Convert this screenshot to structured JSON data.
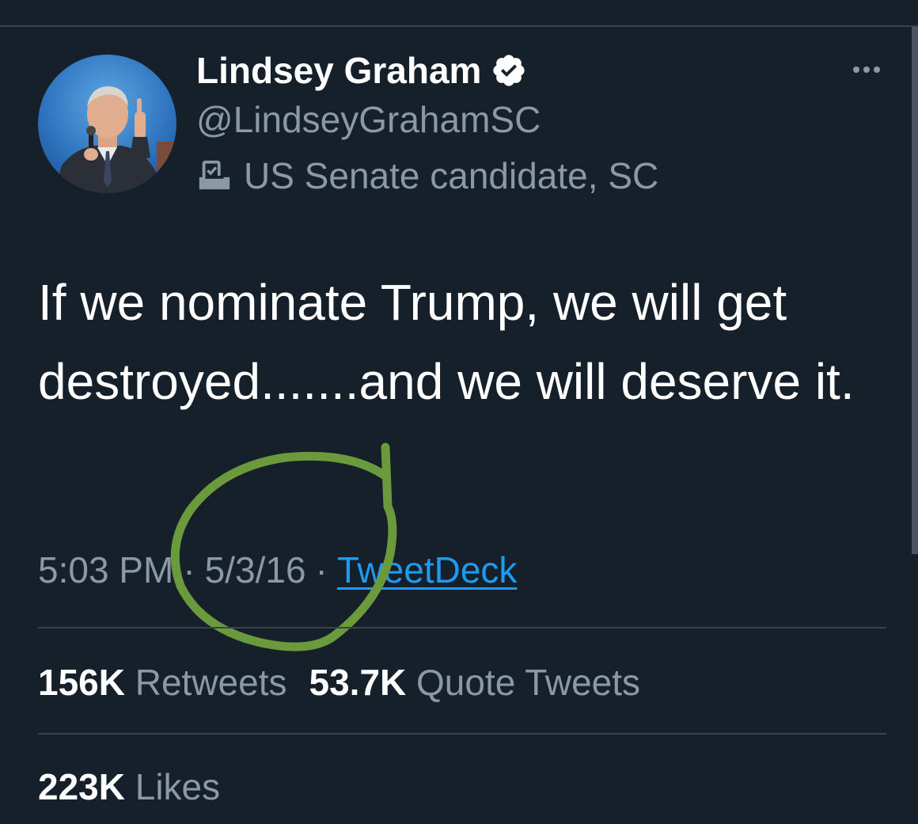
{
  "tweet": {
    "author": {
      "display_name": "Lindsey Graham",
      "handle": "@LindseyGrahamSC",
      "label_icon": "ballot-box-icon",
      "label_text": "US Senate candidate, SC",
      "verified": true,
      "avatar_description": "profile photo"
    },
    "more_icon": "more-horizontal-icon",
    "text": "If we nominate Trump, we will get destroyed.......and we will deserve it.",
    "time": "5:03 PM",
    "separator": "·",
    "date": "5/3/16",
    "source": "TweetDeck",
    "stats": {
      "retweets_count": "156K",
      "retweets_label": "Retweets",
      "quote_tweets_count": "53.7K",
      "quote_tweets_label": "Quote Tweets",
      "likes_count": "223K",
      "likes_label": "Likes"
    }
  },
  "colors": {
    "background": "#15202b",
    "primary_text": "#ffffff",
    "secondary_text": "#8b98a5",
    "link": "#1d9bf0",
    "divider": "#38444d",
    "annotation": "#6a9a3c"
  }
}
